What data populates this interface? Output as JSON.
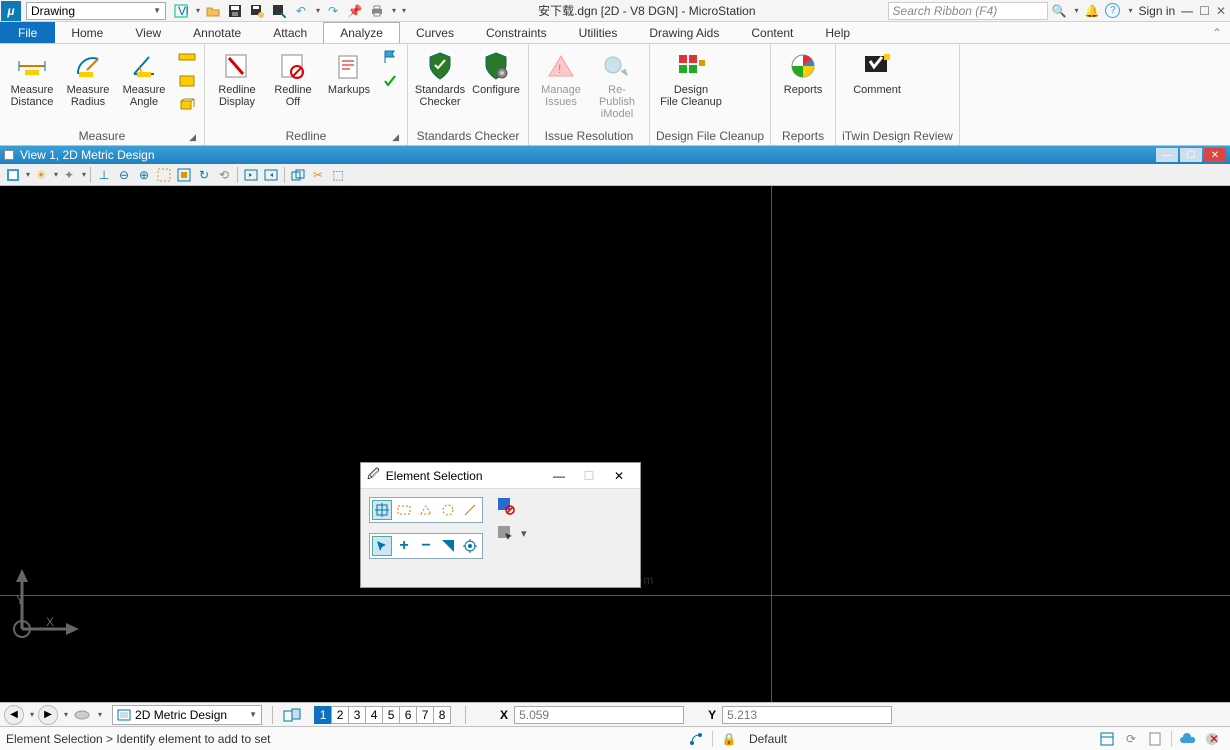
{
  "title": "安下载.dgn [2D - V8 DGN] - MicroStation",
  "workflow": "Drawing",
  "search_placeholder": "Search Ribbon (F4)",
  "signin": "Sign in",
  "menu": {
    "file": "File",
    "home": "Home",
    "view": "View",
    "annotate": "Annotate",
    "attach": "Attach",
    "analyze": "Analyze",
    "curves": "Curves",
    "constraints": "Constraints",
    "utilities": "Utilities",
    "drawing_aids": "Drawing Aids",
    "content": "Content",
    "help": "Help"
  },
  "ribbon": {
    "measure": {
      "label": "Measure",
      "distance": "Measure\nDistance",
      "radius": "Measure\nRadius",
      "angle": "Measure\nAngle"
    },
    "redline": {
      "label": "Redline",
      "display": "Redline\nDisplay",
      "off": "Redline\nOff",
      "markups": "Markups"
    },
    "standards": {
      "label": "Standards Checker",
      "checker": "Standards\nChecker",
      "configure": "Configure"
    },
    "issue": {
      "label": "Issue Resolution",
      "manage": "Manage\nIssues",
      "republish": "Re-Publish\niModel"
    },
    "cleanup": {
      "label": "Design File Cleanup",
      "btn": "Design\nFile Cleanup"
    },
    "reports": {
      "label": "Reports",
      "btn": "Reports"
    },
    "itwin": {
      "label": "iTwin Design Review",
      "btn": "Comment"
    }
  },
  "view_title": "View 1, 2D Metric Design",
  "dialog": {
    "title": "Element Selection"
  },
  "bottom": {
    "model": "2D Metric Design",
    "views": [
      "1",
      "2",
      "3",
      "4",
      "5",
      "6",
      "7",
      "8"
    ],
    "x_label": "X",
    "x_val": "5.059",
    "y_label": "Y",
    "y_val": "5.213"
  },
  "status": {
    "text": "Element Selection > Identify element to add to set",
    "level": "Default"
  },
  "watermark": "安下载\nanxz.com"
}
